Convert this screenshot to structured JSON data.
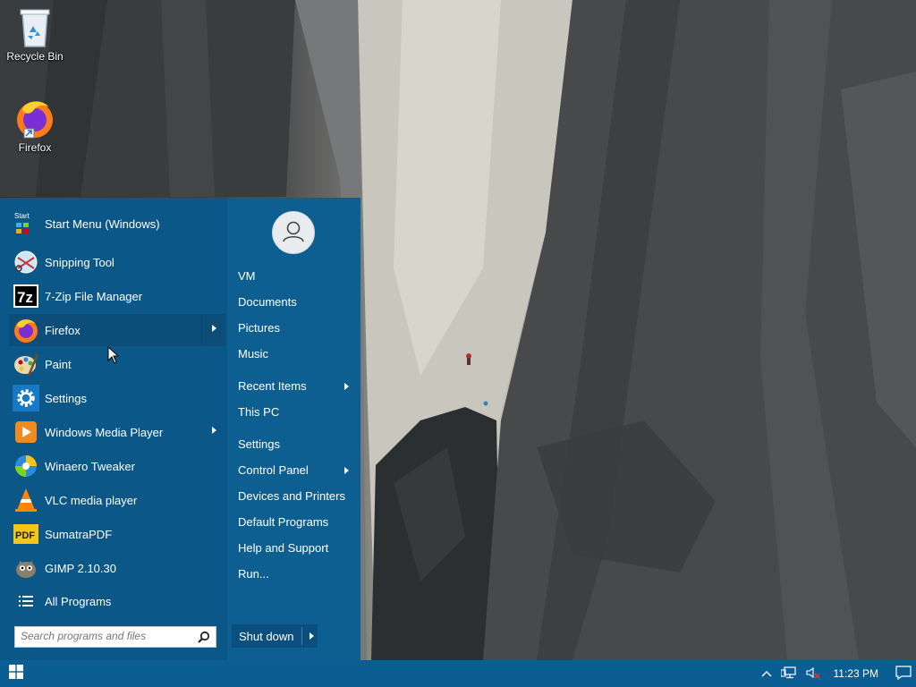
{
  "desktop": {
    "icons": [
      {
        "label": "Recycle Bin",
        "icon": "recycle-bin-icon"
      },
      {
        "label": "Firefox",
        "icon": "firefox-icon"
      }
    ]
  },
  "start_menu": {
    "programs": [
      {
        "label": "Start Menu (Windows)",
        "icon": "start-menu-icon",
        "submenu": false
      },
      {
        "label": "Snipping Tool",
        "icon": "snipping-tool-icon",
        "submenu": false
      },
      {
        "label": "7-Zip File Manager",
        "icon": "7zip-icon",
        "submenu": false
      },
      {
        "label": "Firefox",
        "icon": "firefox-icon",
        "submenu": true,
        "hovered": true
      },
      {
        "label": "Paint",
        "icon": "paint-icon",
        "submenu": false
      },
      {
        "label": "Settings",
        "icon": "gear-icon",
        "submenu": false
      },
      {
        "label": "Windows Media Player",
        "icon": "media-player-icon",
        "submenu": true
      },
      {
        "label": "Winaero Tweaker",
        "icon": "winaero-tweaker-icon",
        "submenu": false
      },
      {
        "label": "VLC media player",
        "icon": "vlc-icon",
        "submenu": false
      },
      {
        "label": "SumatraPDF",
        "icon": "sumatrapdf-icon",
        "submenu": false
      },
      {
        "label": "GIMP 2.10.30",
        "icon": "gimp-icon",
        "submenu": false
      }
    ],
    "all_programs": "All Programs",
    "search_placeholder": "Search programs and files",
    "right_items": [
      {
        "label": "VM",
        "submenu": false
      },
      {
        "label": "Documents",
        "submenu": false
      },
      {
        "label": "Pictures",
        "submenu": false
      },
      {
        "label": "Music",
        "submenu": false
      },
      {
        "label": "Recent Items",
        "submenu": true
      },
      {
        "label": "This PC",
        "submenu": false
      },
      {
        "label": "Settings",
        "submenu": false
      },
      {
        "label": "Control Panel",
        "submenu": true
      },
      {
        "label": "Devices and Printers",
        "submenu": false
      },
      {
        "label": "Default Programs",
        "submenu": false
      },
      {
        "label": "Help and Support",
        "submenu": false
      },
      {
        "label": "Run...",
        "submenu": false
      }
    ],
    "shutdown_label": "Shut down"
  },
  "taskbar": {
    "clock": "11:23 PM",
    "accent": "#0b5e93"
  },
  "colors": {
    "menu_left": "#0a5788",
    "menu_right": "#0d5f92",
    "hover": "#0c4d7a"
  }
}
